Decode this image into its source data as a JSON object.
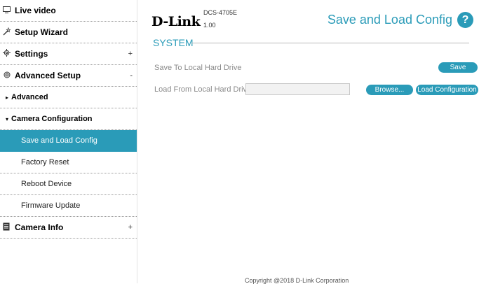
{
  "sidebar": {
    "items": [
      {
        "label": "Live video",
        "icon": "monitor-icon",
        "sign": ""
      },
      {
        "label": "Setup Wizard",
        "icon": "wand-icon",
        "sign": ""
      },
      {
        "label": "Settings",
        "icon": "gear-icon",
        "sign": "+"
      },
      {
        "label": "Advanced Setup",
        "icon": "gears-icon",
        "sign": "-"
      },
      {
        "label": "Advanced",
        "icon": "triangle-right-icon"
      },
      {
        "label": "Camera Configuration",
        "icon": "triangle-down-icon"
      },
      {
        "label": "Save and Load Config"
      },
      {
        "label": "Factory Reset"
      },
      {
        "label": "Reboot Device"
      },
      {
        "label": "Firmware Update"
      },
      {
        "label": "Camera Info",
        "icon": "document-icon",
        "sign": "+"
      }
    ]
  },
  "header": {
    "logo": "D-Link",
    "model": "DCS-4705E",
    "firmware": "1.00",
    "page_title": "Save and Load Config",
    "help": "?"
  },
  "main": {
    "section_title": "SYSTEM",
    "save_label": "Save To Local Hard Drive",
    "save_button": "Save",
    "load_label": "Load From Local Hard Drive",
    "file_value": "",
    "browse_button": "Browse...",
    "load_button": "Load Configuration"
  },
  "footer": {
    "copyright": "Copyright @2018 D-Link Corporation"
  },
  "colors": {
    "accent": "#2a9bb8"
  }
}
